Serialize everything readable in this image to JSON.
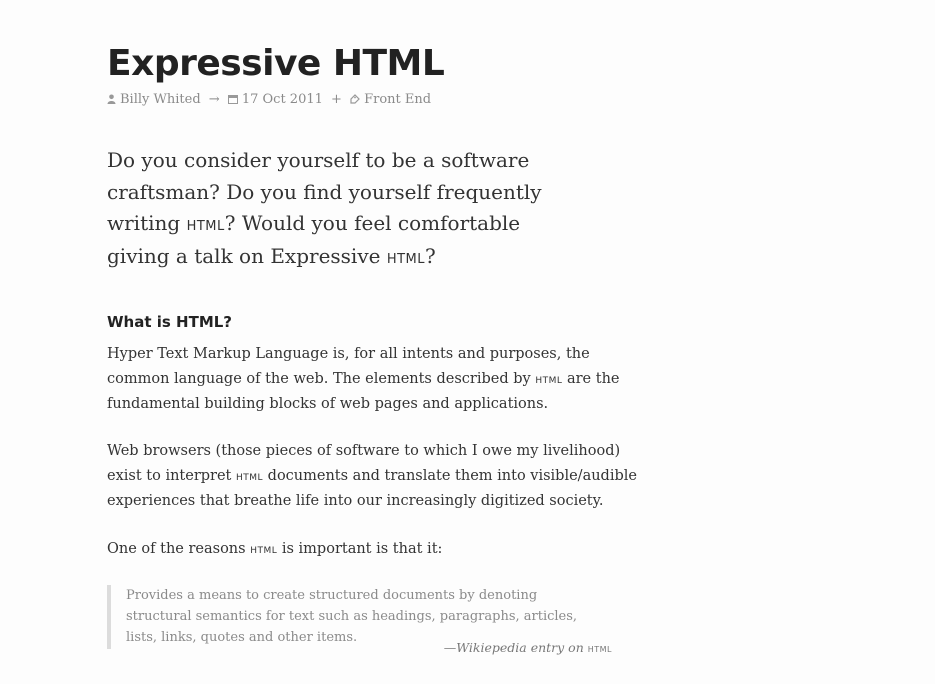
{
  "article": {
    "title": "Expressive HTML",
    "meta": {
      "author": "Billy Whited",
      "date": "17 Oct 2011",
      "category": "Front End",
      "author_icon": "person-icon",
      "date_icon": "calendar-icon",
      "category_icon": "tag-icon",
      "arrow": "→",
      "plus": "+"
    },
    "lead": {
      "part1": "Do you consider yourself to be a software craftsman? Do you find yourself frequently writing ",
      "abbr1": "HTML",
      "part2": "? Would you feel comfortable giving a talk on Expressive ",
      "abbr2": "HTML",
      "part3": "?"
    },
    "section_heading": "What is HTML?",
    "para1": {
      "part1": "Hyper Text Markup Language is, for all intents and purposes, the common language of the web. The elements described by ",
      "abbr": "HTML",
      "part2": " are the fundamental building blocks of web pages and applications."
    },
    "para2": {
      "part1": "Web browsers (those pieces of software to which I owe my livelihood) exist to interpret ",
      "abbr": "HTML",
      "part2": " documents and translate them into visible/audible experiences that breathe life into our increasingly digitized society."
    },
    "para3": {
      "part1": "One of the reasons ",
      "abbr": "HTML",
      "part2": " is important is that it:"
    },
    "quote": {
      "text": "Provides a means to create structured documents by denoting structural semantics for text such as headings, paragraphs, articles, lists, links, quotes and other items.",
      "cite_prefix": "—Wikiepedia entry on ",
      "cite_abbr": "HTML"
    }
  }
}
